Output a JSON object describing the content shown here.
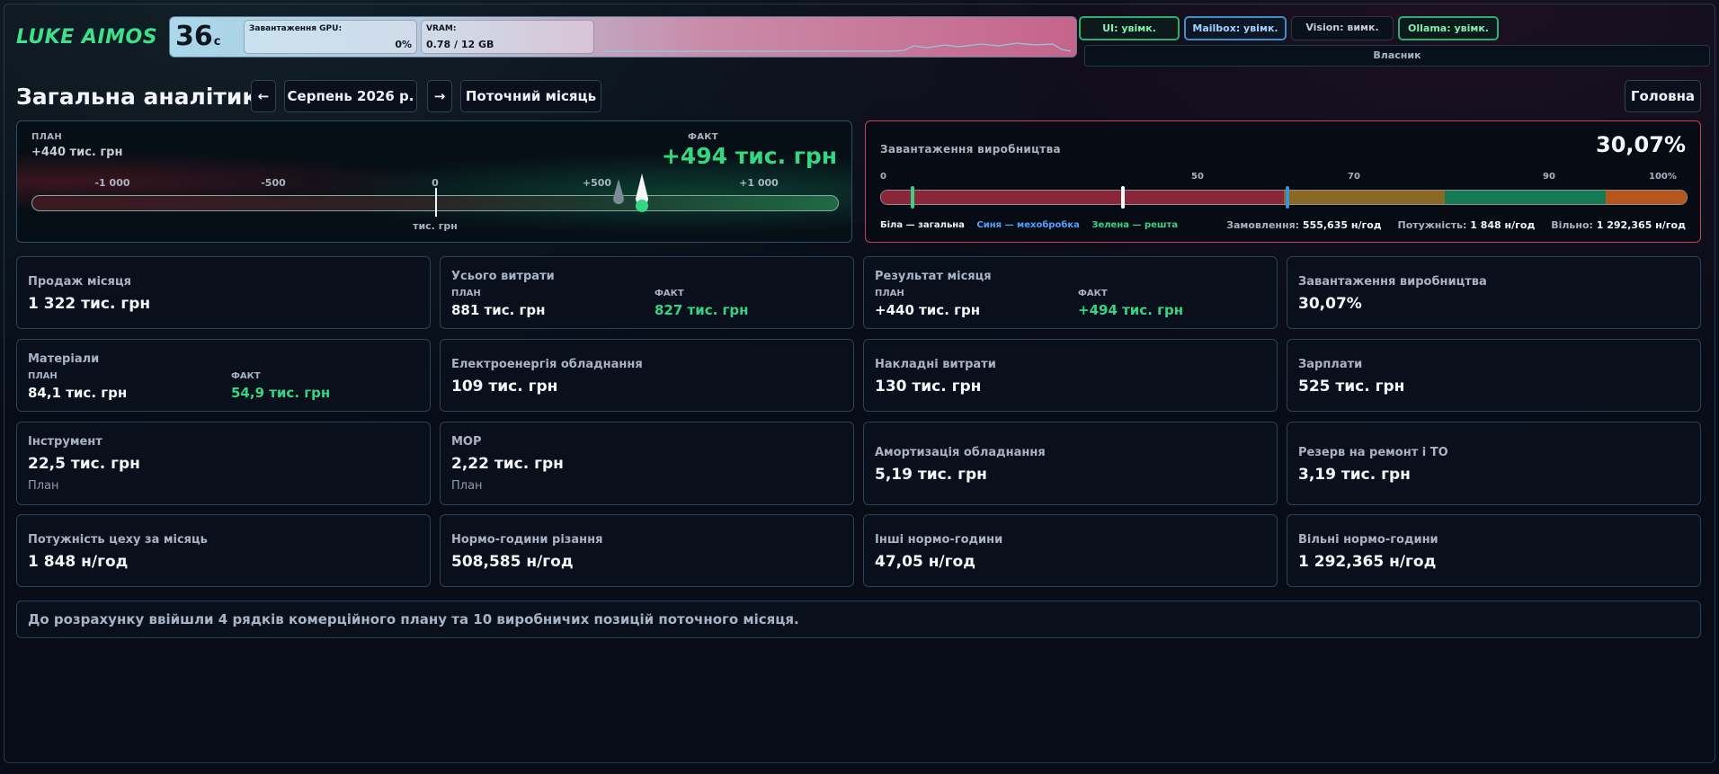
{
  "brand": "LUKE AIMOS",
  "gpu": {
    "temp": "36",
    "temp_unit": "c",
    "load_label": "Завантаження GPU:",
    "load_value": "0%",
    "vram_label": "VRAM:",
    "vram_value": "0.78 / 12 GB"
  },
  "toggles": [
    {
      "label": "UI: увімк."
    },
    {
      "label": "Mailbox: увімк."
    },
    {
      "label": "Vision: вимк."
    },
    {
      "label": "Ollama: увімк."
    }
  ],
  "owner": "Власник",
  "header": {
    "title": "Загальна аналітика",
    "prev": "←",
    "period": "Серпень 2026 р.",
    "next": "→",
    "current": "Поточний місяць",
    "home": "Головна"
  },
  "result_gauge": {
    "plan_label": "ПЛАН",
    "plan_value": "+440 тис. грн",
    "fact_label": "ФАКТ",
    "fact_value": "+494 тис. грн",
    "ticks": [
      "-1 000",
      "-500",
      "0",
      "+500",
      "+1 000"
    ],
    "unit": "тис. грн",
    "plan": 440,
    "fact": 494,
    "min": -1250,
    "max": 1250
  },
  "load_gauge": {
    "label": "Завантаження виробництва",
    "value": "30,07%",
    "ticks": [
      "0",
      "50",
      "70",
      "90",
      "100%"
    ],
    "legend_white": "Біла — загальна",
    "legend_blue": "Синя — мехобробка",
    "legend_green": "Зелена — решта",
    "orders_label": "Замовлення:",
    "orders_value": "555,635 н/год",
    "capacity_label": "Потужність:",
    "capacity_value": "1 848 н/год",
    "free_label": "Вільно:",
    "free_value": "1 292,365 н/год",
    "colors": {
      "red": "#8a2638",
      "amber": "#8a6a22",
      "green": "#167a55",
      "orange": "#b5561c",
      "white": "#ffffff",
      "blue": "#3f8fd8",
      "mark_green": "#37d488"
    }
  },
  "cards": {
    "sales": {
      "title": "Продаж місяця",
      "value": "1 322 тис. грн"
    },
    "total_costs": {
      "title": "Усього витрати",
      "plan_label": "ПЛАН",
      "plan": "881 тис. грн",
      "fact_label": "ФАКТ",
      "fact": "827 тис. грн"
    },
    "month_result": {
      "title": "Результат місяця",
      "plan_label": "ПЛАН",
      "plan": "+440 тис. грн",
      "fact_label": "ФАКТ",
      "fact": "+494 тис. грн"
    },
    "prod_load": {
      "title": "Завантаження виробництва",
      "value": "30,07%"
    },
    "materials": {
      "title": "Матеріали",
      "plan_label": "ПЛАН",
      "plan": "84,1 тис. грн",
      "fact_label": "ФАКТ",
      "fact": "54,9 тис. грн"
    },
    "electricity": {
      "title": "Електроенергія обладнання",
      "value": "109 тис. грн"
    },
    "overhead": {
      "title": "Накладні витрати",
      "value": "130 тис. грн"
    },
    "salaries": {
      "title": "Зарплати",
      "value": "525 тис. грн"
    },
    "tools": {
      "title": "Інструмент",
      "value": "22,5 тис. грн",
      "note": "План"
    },
    "mor": {
      "title": "МОР",
      "value": "2,22 тис. грн",
      "note": "План"
    },
    "depreciation": {
      "title": "Амортизація обладнання",
      "value": "5,19 тис. грн"
    },
    "reserve": {
      "title": "Резерв на ремонт і ТО",
      "value": "3,19 тис. грн"
    },
    "capacity": {
      "title": "Потужність цеху за місяць",
      "value": "1 848 н/год"
    },
    "cutting_hours": {
      "title": "Нормо-години різання",
      "value": "508,585 н/год"
    },
    "other_hours": {
      "title": "Інші нормо-години",
      "value": "47,05 н/год"
    },
    "free_hours": {
      "title": "Вільні нормо-години",
      "value": "1 292,365 н/год"
    }
  },
  "footer": "До розрахунку ввійшли 4 рядків комерційного плану та 10 виробничих позицій поточного місяця."
}
